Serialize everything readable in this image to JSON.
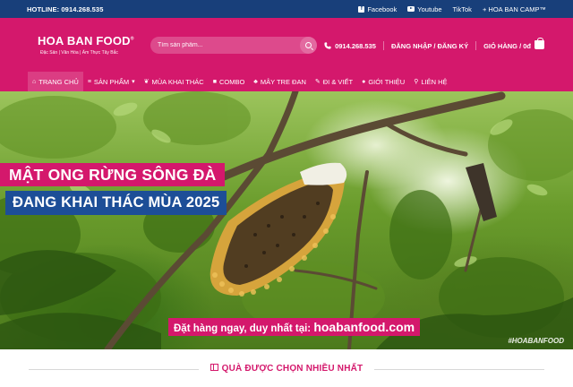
{
  "topbar": {
    "hotline": "HOTLINE: 0914.268.535",
    "facebook": "Facebook",
    "youtube": "Youtube",
    "tiktok": "TikTok",
    "camp": "+ HOA BAN CAMP™"
  },
  "header": {
    "logo_name": "HOA BAN FOOD",
    "logo_mark": "®",
    "logo_tagline": "Đặc Sản | Văn Hóa | Ẩm Thực Tây Bắc",
    "search_placeholder": "Tìm sản phẩm...",
    "phone": "0914.268.535",
    "login": "ĐĂNG NHẬP / ĐĂNG KÝ",
    "cart": "GIỎ HÀNG / 0đ"
  },
  "nav": {
    "items": [
      {
        "label": "TRANG CHỦ",
        "icon": "home-icon"
      },
      {
        "label": "SẢN PHẨM",
        "icon": "list-icon"
      },
      {
        "label": "MÙA KHAI THÁC",
        "icon": "leaf-icon"
      },
      {
        "label": "COMBO",
        "icon": "bag-icon"
      },
      {
        "label": "MÂY TRE ĐAN",
        "icon": "basket-icon"
      },
      {
        "label": "ĐI & VIẾT",
        "icon": "pen-icon"
      },
      {
        "label": "GIỚI THIỆU",
        "icon": "info-icon"
      },
      {
        "label": "LIÊN HỆ",
        "icon": "pin-icon"
      }
    ]
  },
  "hero": {
    "headline1": "MẬT ONG RỪNG SÔNG ĐÀ",
    "headline2": "ĐANG KHAI THÁC MÙA 2025",
    "order_text": "Đặt hàng ngay, duy nhất tại: ",
    "order_site": "hoabanfood.com",
    "hashtag": "#HOABANFOOD"
  },
  "section": {
    "title": "QUÀ ĐƯỢC CHỌN NHIỀU NHẤT"
  },
  "colors": {
    "brand_pink": "#d4186c",
    "brand_blue": "#1d4e97",
    "topbar_blue": "#183f7a"
  }
}
